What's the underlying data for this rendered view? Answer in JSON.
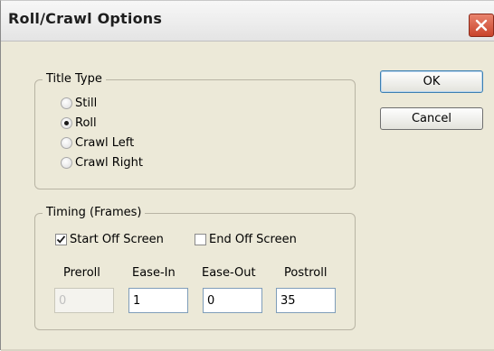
{
  "window": {
    "title": "Roll/Crawl Options"
  },
  "title_type": {
    "legend": "Title Type",
    "options": [
      {
        "label": "Still",
        "selected": false
      },
      {
        "label": "Roll",
        "selected": true
      },
      {
        "label": "Crawl Left",
        "selected": false
      },
      {
        "label": "Crawl Right",
        "selected": false
      }
    ]
  },
  "timing": {
    "legend": "Timing (Frames)",
    "start_off_screen": {
      "label": "Start Off Screen",
      "checked": true
    },
    "end_off_screen": {
      "label": "End Off Screen",
      "checked": false
    },
    "fields": {
      "preroll": {
        "label": "Preroll",
        "value": "0",
        "enabled": false
      },
      "ease_in": {
        "label": "Ease-In",
        "value": "1",
        "enabled": true
      },
      "ease_out": {
        "label": "Ease-Out",
        "value": "0",
        "enabled": true
      },
      "postroll": {
        "label": "Postroll",
        "value": "35",
        "enabled": true
      }
    }
  },
  "buttons": {
    "ok": "OK",
    "cancel": "Cancel"
  },
  "colors": {
    "dialog_bg": "#ece9d8",
    "close_button": "#d2553c",
    "default_button_border": "#3c7fb1"
  },
  "icons": {
    "close": "close-x-icon",
    "checkmark": "checkmark-icon"
  }
}
